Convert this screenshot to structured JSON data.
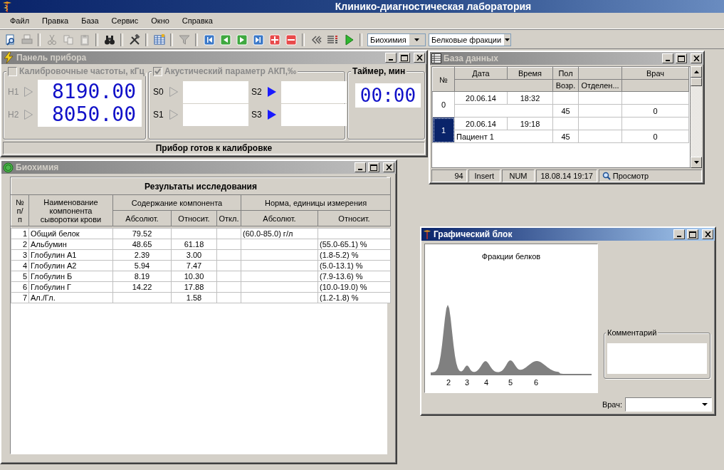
{
  "app": {
    "title": "Клинико-диагностическая лаборатория"
  },
  "menu": [
    "Файл",
    "Правка",
    "База",
    "Сервис",
    "Окно",
    "Справка"
  ],
  "toolbar": {
    "buttons": [
      {
        "kind": "preview",
        "disabled": false
      },
      {
        "kind": "print",
        "disabled": true
      },
      {
        "kind": "cut",
        "disabled": true
      },
      {
        "kind": "copy",
        "disabled": true
      },
      {
        "kind": "paste",
        "disabled": true
      },
      {
        "kind": "binoculars",
        "disabled": false
      },
      {
        "kind": "tools",
        "disabled": false
      },
      {
        "kind": "table",
        "disabled": false
      },
      {
        "kind": "filter",
        "disabled": true
      },
      {
        "kind": "first",
        "disabled": false
      },
      {
        "kind": "prev",
        "disabled": false
      },
      {
        "kind": "next",
        "disabled": false
      },
      {
        "kind": "last",
        "disabled": false
      },
      {
        "kind": "add",
        "disabled": false
      },
      {
        "kind": "remove",
        "disabled": false
      },
      {
        "kind": "rewind",
        "disabled": false
      },
      {
        "kind": "list",
        "disabled": false
      },
      {
        "kind": "play",
        "disabled": false
      }
    ],
    "combos": [
      {
        "value": "Биохимия"
      },
      {
        "value": "Белковые фракции"
      }
    ]
  },
  "device_panel": {
    "title": "Панель прибора",
    "active": false,
    "calibration": {
      "label": "Калибровочные частоты, кГц",
      "checked": false,
      "disabled": true,
      "channels": [
        {
          "name": "H1",
          "active": false,
          "value": "8190.00"
        },
        {
          "name": "H2",
          "active": false,
          "value": "8050.00"
        }
      ]
    },
    "acoustic": {
      "label": "Акустический параметр АКП,‰",
      "checked": true,
      "disabled": true,
      "channels": [
        {
          "name": "S0",
          "active": false
        },
        {
          "name": "S1",
          "active": false
        },
        {
          "name": "S2",
          "active": true
        },
        {
          "name": "S3",
          "active": true
        }
      ]
    },
    "timer": {
      "label": "Таймер, мин",
      "value": "00:00"
    },
    "status": "Прибор готов к калибровке"
  },
  "database": {
    "title": "База данных",
    "active": false,
    "header": {
      "number": "№",
      "date": "Дата",
      "time": "Время",
      "sex": "Пол",
      "doctor": "Врач",
      "age": "Возр.",
      "department": "Отделен..."
    },
    "records": [
      {
        "no": "0",
        "date": "20.06.14",
        "time": "18:32",
        "age": "45",
        "doctor": "0",
        "selected": false
      },
      {
        "no": "1",
        "date": "20.06.14",
        "time": "19:18",
        "name": "Пациент 1",
        "age": "45",
        "doctor": "0",
        "selected": true
      }
    ],
    "status_bar": [
      "94",
      "Insert",
      "NUM",
      "18.08.14 19:17",
      "Просмотр"
    ]
  },
  "biochemistry": {
    "title": "Биохимия",
    "active": false,
    "table_title": "Результаты исследования",
    "header": {
      "no": "№ п/п",
      "name": "Наименование компонента сыворотки крови",
      "content": "Содержание компонента",
      "norm": "Норма, единицы измерения",
      "abs": "Абсолют.",
      "rel": "Относит.",
      "dev": "Откл.",
      "norm_abs": "Абсолют.",
      "norm_rel": "Относит."
    },
    "rows": [
      {
        "no": "1",
        "name": "Общий белок",
        "abs": "79.52",
        "norm_abs": "(60.0-85.0) г/л"
      },
      {
        "no": "2",
        "name": "Альбумин",
        "abs": "48.65",
        "rel": "61.18",
        "norm_rel": "(55.0-65.1) %"
      },
      {
        "no": "3",
        "name": "Глобулин А1",
        "abs": "2.39",
        "rel": "3.00",
        "norm_rel": "(1.8-5.2) %"
      },
      {
        "no": "4",
        "name": "Глобулин А2",
        "abs": "5.94",
        "rel": "7.47",
        "norm_rel": "(5.0-13.1) %"
      },
      {
        "no": "5",
        "name": "Глобулин Б",
        "abs": "8.19",
        "rel": "10.30",
        "norm_rel": "(7.9-13.6) %"
      },
      {
        "no": "6",
        "name": "Глобулин Г",
        "abs": "14.22",
        "rel": "17.88",
        "norm_rel": "(10.0-19.0) %"
      },
      {
        "no": "7",
        "name": "Ал./Гл.",
        "rel": "1.58",
        "norm_rel": "(1.2-1.8) %"
      }
    ]
  },
  "graphic_block": {
    "title": "Графический блок",
    "active": true,
    "chart_title": "Фракции белков",
    "peak_labels": [
      "2",
      "3",
      "4",
      "5",
      "6"
    ],
    "comment_label": "Комментарий",
    "doctor_label": "Врач:"
  }
}
